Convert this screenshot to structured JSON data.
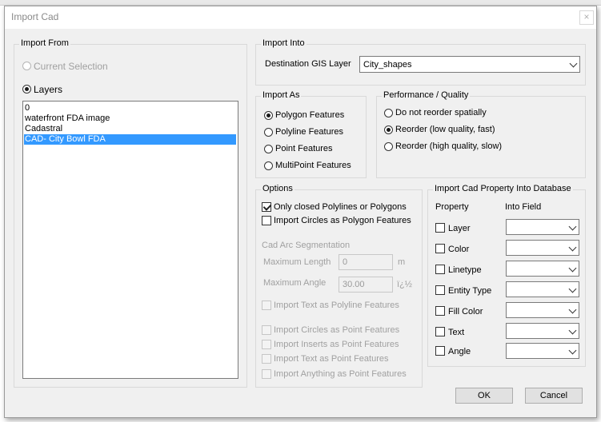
{
  "window": {
    "title": "Import Cad",
    "close_glyph": "×"
  },
  "import_from": {
    "label": "Import From",
    "current_selection": "Current Selection",
    "layers": "Layers",
    "list": [
      "0",
      "waterfront FDA image",
      "Cadastral",
      "CAD- City Bowl FDA"
    ],
    "selected_index": 3
  },
  "import_into": {
    "label": "Import Into",
    "dest_label": "Destination GIS Layer",
    "dest_value": "City_shapes"
  },
  "import_as": {
    "label": "Import As",
    "options": [
      "Polygon Features",
      "Polyline Features",
      "Point Features",
      "MultiPoint Features"
    ],
    "selected_index": 0
  },
  "performance": {
    "label": "Performance / Quality",
    "options": [
      "Do not reorder spatially",
      "Reorder (low quality, fast)",
      "Reorder (high quality, slow)"
    ],
    "selected_index": 1
  },
  "options": {
    "label": "Options",
    "closed_polylines": "Only closed Polylines or Polygons",
    "circles_polygon": "Import Circles as Polygon Features",
    "arc_segmentation": "Cad Arc Segmentation",
    "max_length_label": "Maximum Length",
    "max_length_value": "0",
    "max_length_unit": "m",
    "max_angle_label": "Maximum Angle",
    "max_angle_value": "30.00",
    "max_angle_unit": "ï¿½",
    "text_polyline": "Import Text as Polyline Features",
    "circles_point": "Import Circles as Point Features",
    "inserts_point": "Import Inserts as Point Features",
    "text_point": "Import Text as Point Features",
    "anything_point": "Import Anything as Point Features"
  },
  "cad_property": {
    "label": "Import Cad Property Into Database",
    "col_property": "Property",
    "col_field": "Into Field",
    "rows": [
      "Layer",
      "Color",
      "Linetype",
      "Entity Type",
      "Fill Color",
      "Text",
      "Angle"
    ]
  },
  "buttons": {
    "ok": "OK",
    "cancel": "Cancel"
  },
  "icons": {
    "close": "close-icon",
    "dropdown": "chevron-down-icon"
  }
}
